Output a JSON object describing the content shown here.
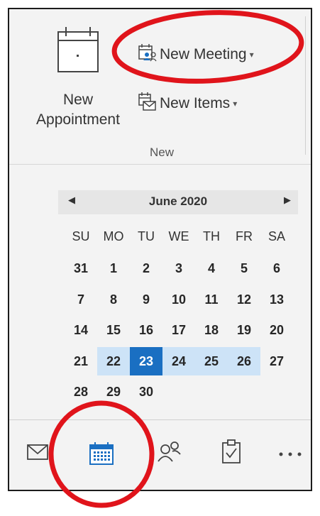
{
  "ribbon": {
    "new_appointment_label": "New Appointment",
    "new_meeting_label": "New Meeting",
    "new_items_label": "New Items",
    "group_label": "New"
  },
  "calendar": {
    "month_title": "June 2020",
    "days_of_week": [
      "SU",
      "MO",
      "TU",
      "WE",
      "TH",
      "FR",
      "SA"
    ],
    "weeks": [
      [
        "31",
        "1",
        "2",
        "3",
        "4",
        "5",
        "6"
      ],
      [
        "7",
        "8",
        "9",
        "10",
        "11",
        "12",
        "13"
      ],
      [
        "14",
        "15",
        "16",
        "17",
        "18",
        "19",
        "20"
      ],
      [
        "21",
        "22",
        "23",
        "24",
        "25",
        "26",
        "27"
      ],
      [
        "28",
        "29",
        "30",
        "",
        "",
        "",
        ""
      ]
    ],
    "selected_week_index": 3,
    "today": "23"
  },
  "navbar": {
    "items": [
      "mail-icon",
      "calendar-icon",
      "people-icon",
      "tasks-icon",
      "more-icon"
    ],
    "active": "calendar-icon"
  },
  "colors": {
    "today_bg": "#1a6fc2",
    "week_highlight": "#cde3f7",
    "annotation": "#e0141b"
  }
}
